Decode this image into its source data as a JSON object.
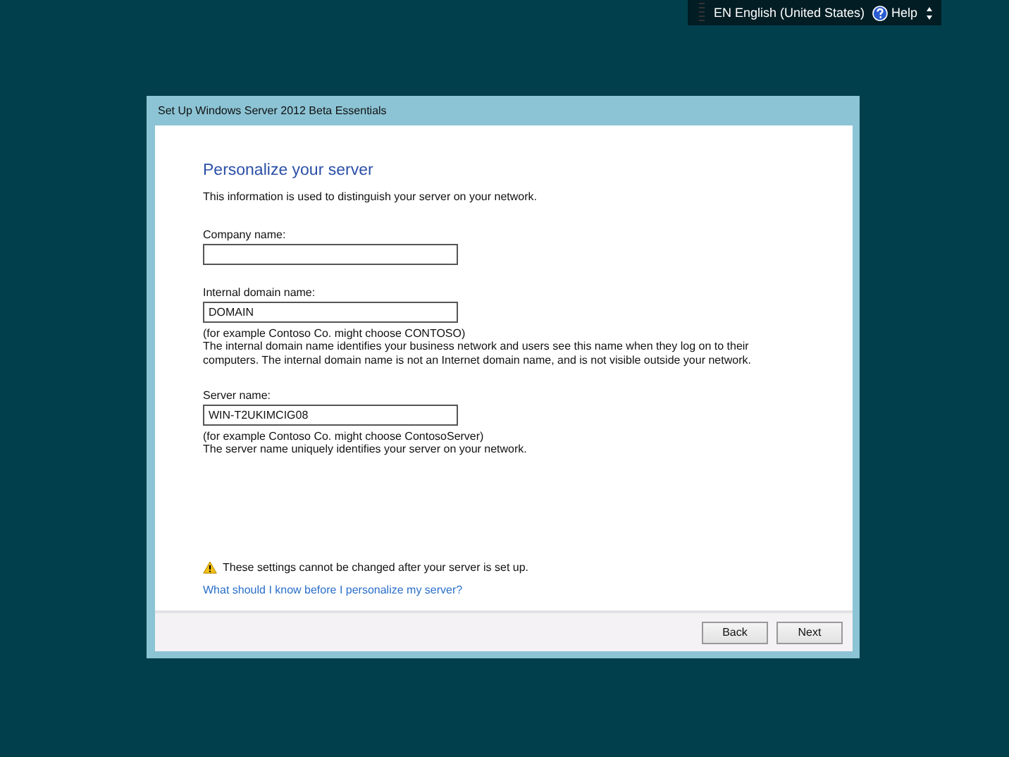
{
  "top_bar": {
    "language": "EN English (United States)",
    "help": "Help"
  },
  "window": {
    "title": "Set Up Windows Server 2012 Beta Essentials"
  },
  "page": {
    "heading": "Personalize your server",
    "intro": "This information is used to distinguish your server on your network.",
    "fields": [
      {
        "label": "Company name:"
      },
      {
        "label": "Internal domain name:",
        "value": "DOMAIN",
        "example": "(for example Contoso Co. might choose CONTOSO)",
        "description": "The internal domain name identifies your business network and users see this name when they log on to their computers. The internal domain name is not an Internet domain name, and is not visible outside your network."
      },
      {
        "label": "Server name:",
        "value": "WIN-T2UKIMCIG08",
        "example": "(for example Contoso Co. might choose ContosoServer)",
        "description": "The server name uniquely identifies your server on your network."
      }
    ],
    "warning": "These settings cannot be changed after your server is set up.",
    "help_link": "What should I know before I personalize my server?"
  },
  "buttons": [
    "Back",
    "Next"
  ]
}
